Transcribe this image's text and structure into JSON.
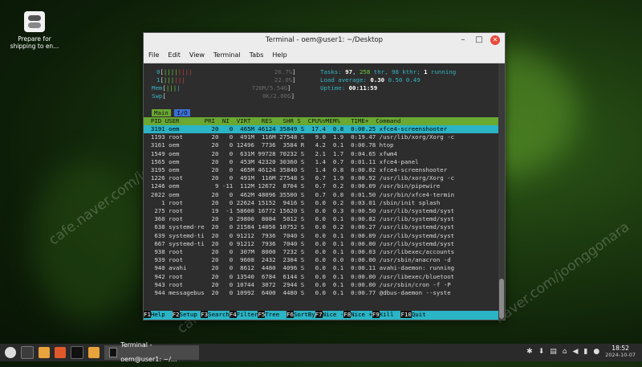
{
  "desktop": {
    "icon_label": "Prepare for shipping to en..."
  },
  "window": {
    "title": "Terminal - oem@user1: ~/Desktop",
    "menu": [
      "File",
      "Edit",
      "View",
      "Terminal",
      "Tabs",
      "Help"
    ]
  },
  "htop": {
    "cpu0_label": "0",
    "cpu0_pct": "26.7%",
    "cpu1_label": "1",
    "cpu1_pct": "22.0%",
    "mem_label": "Mem",
    "mem_val": "720M/5.54G",
    "swp_label": "Swp",
    "swp_val": "0K/2.00G",
    "tasks_label": "Tasks:",
    "tasks": "97",
    "thr": "258",
    "thr_label": "thr,",
    "kthr": "98 kthr;",
    "running": "1",
    "running_label": "running",
    "load_label": "Load average:",
    "load1": "0.30",
    "load5": "0.50",
    "load15": "0.49",
    "uptime_label": "Uptime:",
    "uptime": "00:11:59",
    "tab_main": "Main",
    "tab_io": "I/O",
    "header": "  PID USER       PRI  NI  VIRT   RES   SHR S  CPU%▽MEM%   TIME+  Command",
    "rows": [
      "  3191 oem         20   0  465M 46124 35849 S  17.4  0.8  0:00.25 xfce4-screenshooter",
      "  1193 root        20   0  491M  116M 27548 S   9.0  1.9  0:19.47 /usr/lib/xorg/Xorg -c",
      "  3161 oem         20   0 12496  7736  3584 R   4.2  0.1  0:00.78 htop",
      "  1549 oem         20   0  631M 99728 70232 S   2.1  1.7  0:04.65 xfwm4",
      "  1565 oem         20   0  453M 42320 30360 S   1.4  0.7  0:01.11 xfce4-panel",
      "  3195 oem         20   0  465M 46124 35840 S   1.4  0.8  0:00.02 xfce4-screenshooter",
      "  1226 root        20   0  491M  116M 27548 S   0.7  1.9  0:00.92 /usr/lib/xorg/Xorg -c",
      "  1246 oem          9 -11  112M 12672  8704 S   0.7  0.2  0:00.09 /usr/bin/pipewire",
      "  2022 oem         20   0  462M 48096 35500 S   0.7  0.8  0:01.50 /usr/bin/xfce4-termin",
      "     1 root        20   0 22624 15152  9416 S   0.0  0.2  0:03.01 /sbin/init splash",
      "   275 root        19  -1 58600 16772 15620 S   0.0  0.3  0:00.50 /usr/lib/systemd/syst",
      "   360 root        20   0 29800  8084  5012 S   0.0  0.1  0:00.82 /usr/lib/systemd/syst",
      "   638 systemd-re  20   0 21584 14056 10752 S   0.0  0.2  0:00.27 /usr/lib/systemd/syst",
      "   639 systemd-ti  20   0 91212  7936  7040 S   0.0  0.1  0:00.09 /usr/lib/systemd/syst",
      "   667 systemd-ti  20   0 91212  7936  7040 S   0.0  0.1  0:00.00 /usr/lib/systemd/syst",
      "   938 root        20   0  307M  8000  7232 S   0.0  0.1  0:00.03 /usr/libexec/accounts",
      "   939 root        20   0  9608  2432  2304 S   0.0  0.0  0:00.00 /usr/sbin/anacron -d",
      "   940 avahi       20   0  8612  4480  4096 S   0.0  0.1  0:00.11 avahi-daemon: running",
      "   942 root        20   0 13540  6784  6144 S   0.0  0.1  0:00.00 /usr/libexec/bluetoot",
      "   943 root        20   0 10744  3072  2944 S   0.0  0.1  0:00.00 /usr/sbin/cron -f -P",
      "   944 messagebus  20   0 10992  6400  4480 S   0.0  0.1  0:00.77 @dbus-daemon --syste"
    ],
    "fkeys": [
      {
        "k": "F1",
        "l": "Help  "
      },
      {
        "k": "F2",
        "l": "Setup "
      },
      {
        "k": "F3",
        "l": "Search"
      },
      {
        "k": "F4",
        "l": "Filter"
      },
      {
        "k": "F5",
        "l": "Tree  "
      },
      {
        "k": "F6",
        "l": "SortBy"
      },
      {
        "k": "F7",
        "l": "Nice -"
      },
      {
        "k": "F8",
        "l": "Nice +"
      },
      {
        "k": "F9",
        "l": "Kill  "
      },
      {
        "k": "F10",
        "l": "Quit"
      }
    ]
  },
  "taskbar": {
    "app_label": "Terminal - oem@user1: ~/...",
    "time": "18:52",
    "date": "2024-10-07"
  }
}
